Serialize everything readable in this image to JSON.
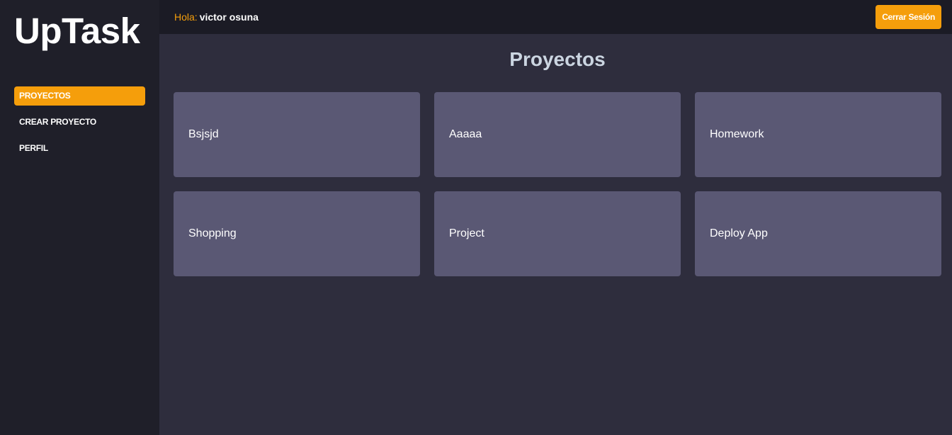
{
  "sidebar": {
    "logo": "UpTask",
    "items": [
      {
        "label": "PROYECTOS",
        "active": true
      },
      {
        "label": "CREAR PROYECTO",
        "active": false
      },
      {
        "label": "PERFIL",
        "active": false
      }
    ]
  },
  "header": {
    "greeting_label": "Hola:",
    "user_name": "victor osuna",
    "logout_label": "Cerrar Sesión"
  },
  "main": {
    "title": "Proyectos",
    "projects": [
      {
        "name": "Bsjsjd"
      },
      {
        "name": "Aaaaa"
      },
      {
        "name": "Homework"
      },
      {
        "name": "Shopping"
      },
      {
        "name": "Project"
      },
      {
        "name": "Deploy App"
      }
    ]
  },
  "colors": {
    "accent": "#f59e0b",
    "sidebar_bg": "#1f1f29",
    "topbar_bg": "#1b1b25",
    "content_bg": "#2e2d3d",
    "card_bg": "#5a5874",
    "title_text": "#cbd5e1"
  }
}
